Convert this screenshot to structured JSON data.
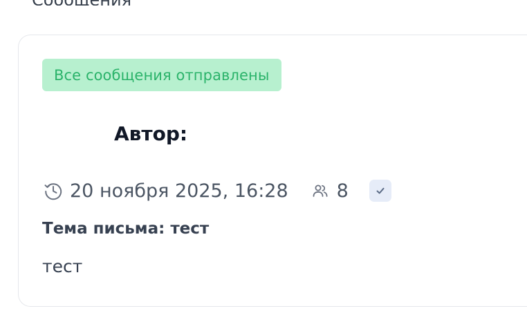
{
  "header_partial": "Сообщения",
  "message_card": {
    "status": "Все сообщения отправлены",
    "author_label": "Автор:",
    "date": "20 ноября 2025, 16:28",
    "recipients_count": "8",
    "subject": "Тема письма: тест",
    "body": "тест"
  },
  "colors": {
    "status_bg": "#b7f0cf",
    "status_text": "#2bb36a",
    "check_bg": "#e6ecf8",
    "muted_text": "#4b5563"
  },
  "icons": [
    "history-clock-icon",
    "people-icon",
    "checkmark-icon"
  ]
}
